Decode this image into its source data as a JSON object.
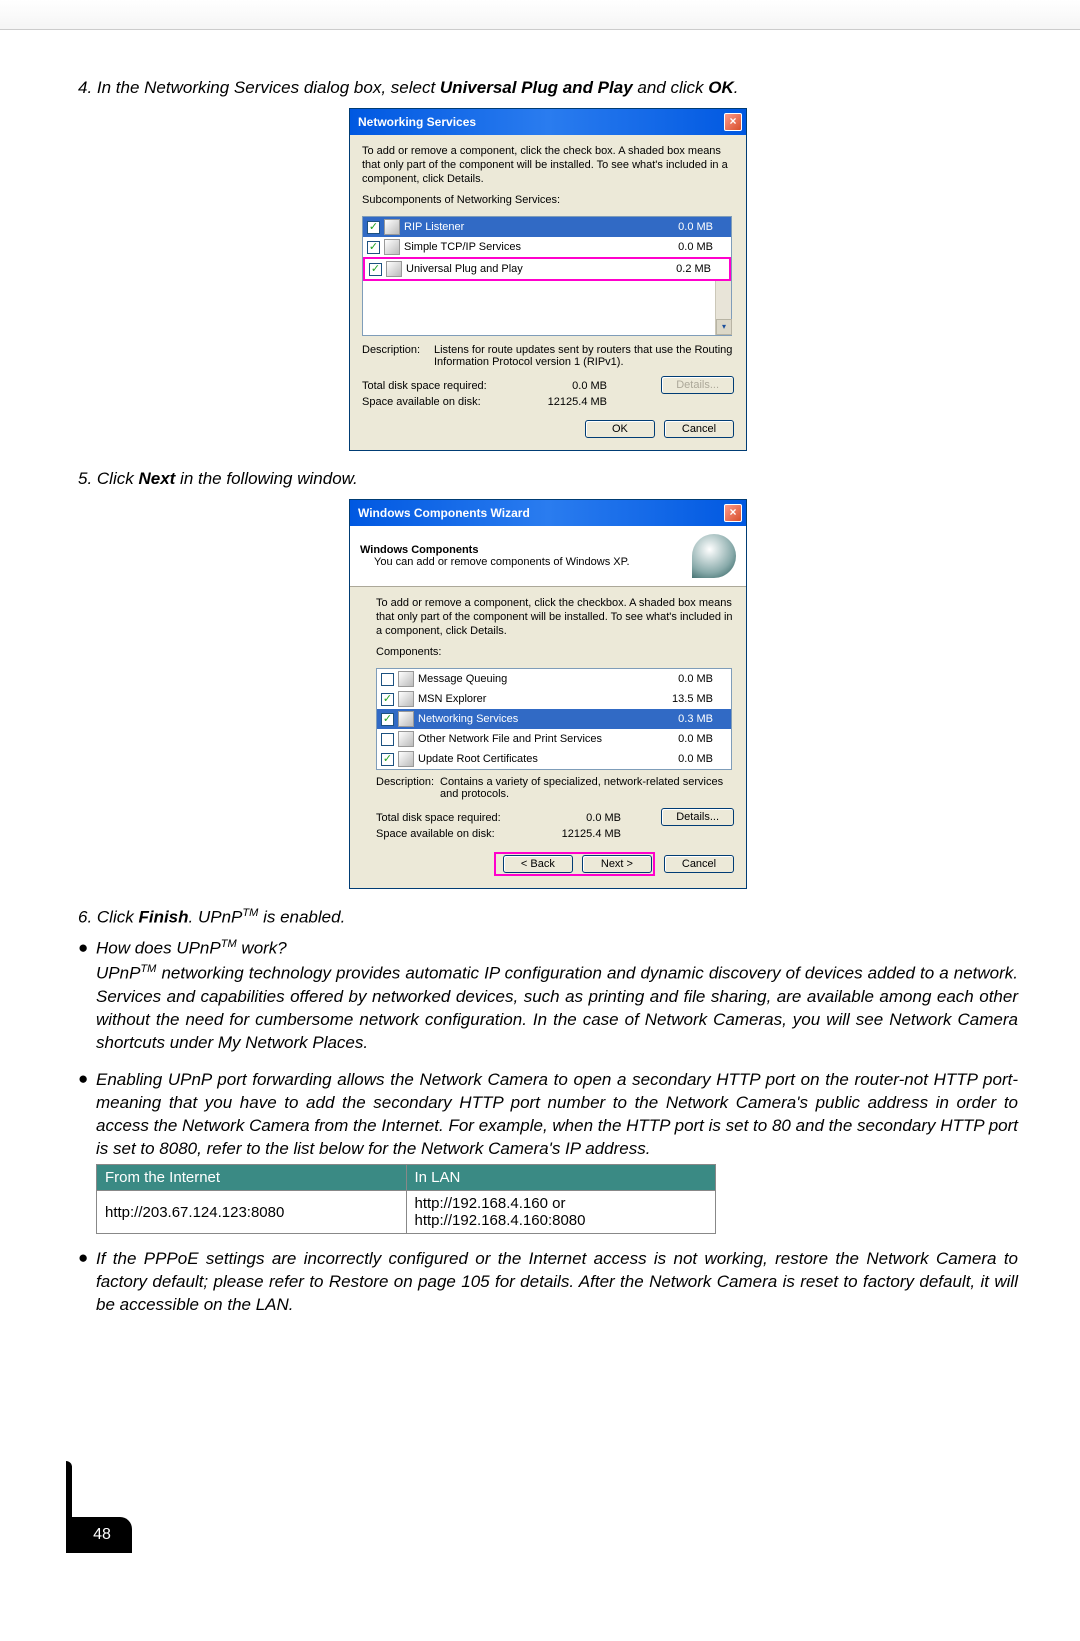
{
  "step4": {
    "text_prefix": "4. In the Networking Services dialog box, select ",
    "bold1": "Universal Plug and Play",
    "mid": " and click ",
    "bold2": "OK",
    "suffix": "."
  },
  "dlg1": {
    "title": "Networking Services",
    "desc": "To add or remove a component, click the check box. A shaded box means that only part of the component will be installed. To see what's included in a component, click Details.",
    "sub_label": "Subcomponents of Networking Services:",
    "rows": [
      {
        "checked": true,
        "label": "RIP Listener",
        "size": "0.0 MB",
        "selected": true
      },
      {
        "checked": true,
        "label": "Simple TCP/IP Services",
        "size": "0.0 MB",
        "selected": false
      },
      {
        "checked": true,
        "label": "Universal Plug and Play",
        "size": "0.2 MB",
        "selected": false
      }
    ],
    "desc_label": "Description:",
    "desc_text": "Listens for route updates sent by routers that use the Routing Information Protocol version 1 (RIPv1).",
    "total_label": "Total disk space required:",
    "total_val": "0.0 MB",
    "avail_label": "Space available on disk:",
    "avail_val": "12125.4 MB",
    "details_btn": "Details...",
    "ok_btn": "OK",
    "cancel_btn": "Cancel"
  },
  "step5": {
    "prefix": "5. Click ",
    "bold": "Next",
    "suffix": " in the following window."
  },
  "dlg2": {
    "title": "Windows Components Wizard",
    "head_title": "Windows Components",
    "head_sub": "You can add or remove components of Windows XP.",
    "body_text": "To add or remove a component, click the checkbox. A shaded box means that only part of the component will be installed. To see what's included in a component, click Details.",
    "comp_label": "Components:",
    "rows": [
      {
        "checked": false,
        "label": "Message Queuing",
        "size": "0.0 MB",
        "selected": false
      },
      {
        "checked": true,
        "label": "MSN Explorer",
        "size": "13.5 MB",
        "selected": false
      },
      {
        "checked": true,
        "label": "Networking Services",
        "size": "0.3 MB",
        "selected": true
      },
      {
        "checked": false,
        "label": "Other Network File and Print Services",
        "size": "0.0 MB",
        "selected": false
      },
      {
        "checked": true,
        "label": "Update Root Certificates",
        "size": "0.0 MB",
        "selected": false
      }
    ],
    "desc_label": "Description:",
    "desc_text": "Contains a variety of specialized, network-related services and protocols.",
    "total_label": "Total disk space required:",
    "total_val": "0.0 MB",
    "avail_label": "Space available on disk:",
    "avail_val": "12125.4 MB",
    "details_btn": "Details...",
    "back_btn": "< Back",
    "next_btn": "Next >",
    "cancel_btn": "Cancel"
  },
  "step6": {
    "prefix": "6. Click ",
    "bold": "Finish",
    "mid": ". UPnP",
    "sup": "TM",
    "suffix": " is enabled."
  },
  "q1": {
    "prefix": "How does UPnP",
    "sup": "TM",
    "suffix": " work?"
  },
  "p1": {
    "prefix": "UPnP",
    "sup": "TM",
    "rest": " networking technology provides automatic IP configuration and dynamic discovery of devices added to a network. Services and capabilities offered by networked devices, such as printing and file sharing, are available among each other without the need for cumbersome network configuration. In the case of Network Cameras, you will see Network Camera shortcuts under My Network Places."
  },
  "p2": "Enabling UPnP port forwarding allows the Network Camera to open a secondary HTTP port on the router-not HTTP port-meaning that you have to add the secondary HTTP port number to the Network Camera's public address in order to access the Network Camera from the Internet. For example, when the HTTP port is set to 80 and the secondary HTTP port is set to 8080, refer to the list below for the Network Camera's IP address.",
  "table": {
    "h1": "From the Internet",
    "h2": "In LAN",
    "c1": "http://203.67.124.123:8080",
    "c2a": "http://192.168.4.160 or",
    "c2b": "http://192.168.4.160:8080"
  },
  "p3": "If the PPPoE settings are incorrectly configured or the Internet access is not working, restore the Network Camera to factory default; please refer to Restore on page 105 for details. After the Network Camera is reset to factory default, it will be accessible on the LAN.",
  "page_number": "48"
}
